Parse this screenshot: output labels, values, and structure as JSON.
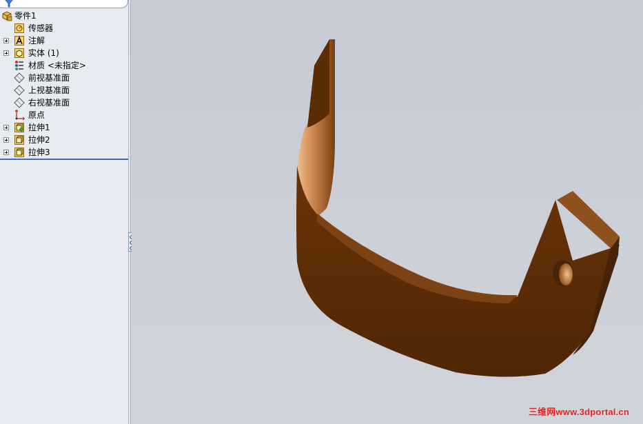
{
  "feature_tree": {
    "root": {
      "label": "零件1",
      "icon": "part-icon"
    },
    "items": [
      {
        "label": "传感器",
        "icon": "sensor-icon",
        "expandable": false
      },
      {
        "label": "注解",
        "icon": "annotation-icon",
        "expandable": true
      },
      {
        "label": "实体 (1)",
        "icon": "solid-body-icon",
        "expandable": true
      },
      {
        "label": "材质 <未指定>",
        "icon": "material-icon",
        "expandable": false
      },
      {
        "label": "前视基准面",
        "icon": "plane-icon",
        "expandable": false
      },
      {
        "label": "上视基准面",
        "icon": "plane-icon",
        "expandable": false
      },
      {
        "label": "右视基准面",
        "icon": "plane-icon",
        "expandable": false
      },
      {
        "label": "原点",
        "icon": "origin-icon",
        "expandable": false
      },
      {
        "label": "拉伸1",
        "icon": "extrude-icon",
        "expandable": true
      },
      {
        "label": "拉伸2",
        "icon": "extrude-icon",
        "expandable": true
      },
      {
        "label": "拉伸3",
        "icon": "extrude-icon",
        "expandable": true
      }
    ]
  },
  "watermark": "三维网www.3dportal.cn",
  "colors": {
    "model_dark": "#5a2c07",
    "model_mid": "#7d4214",
    "model_light": "#e8b27e",
    "tree_bg": "#e8ebf2",
    "viewport_bg": "#c8ccd6",
    "watermark": "#e02020"
  }
}
